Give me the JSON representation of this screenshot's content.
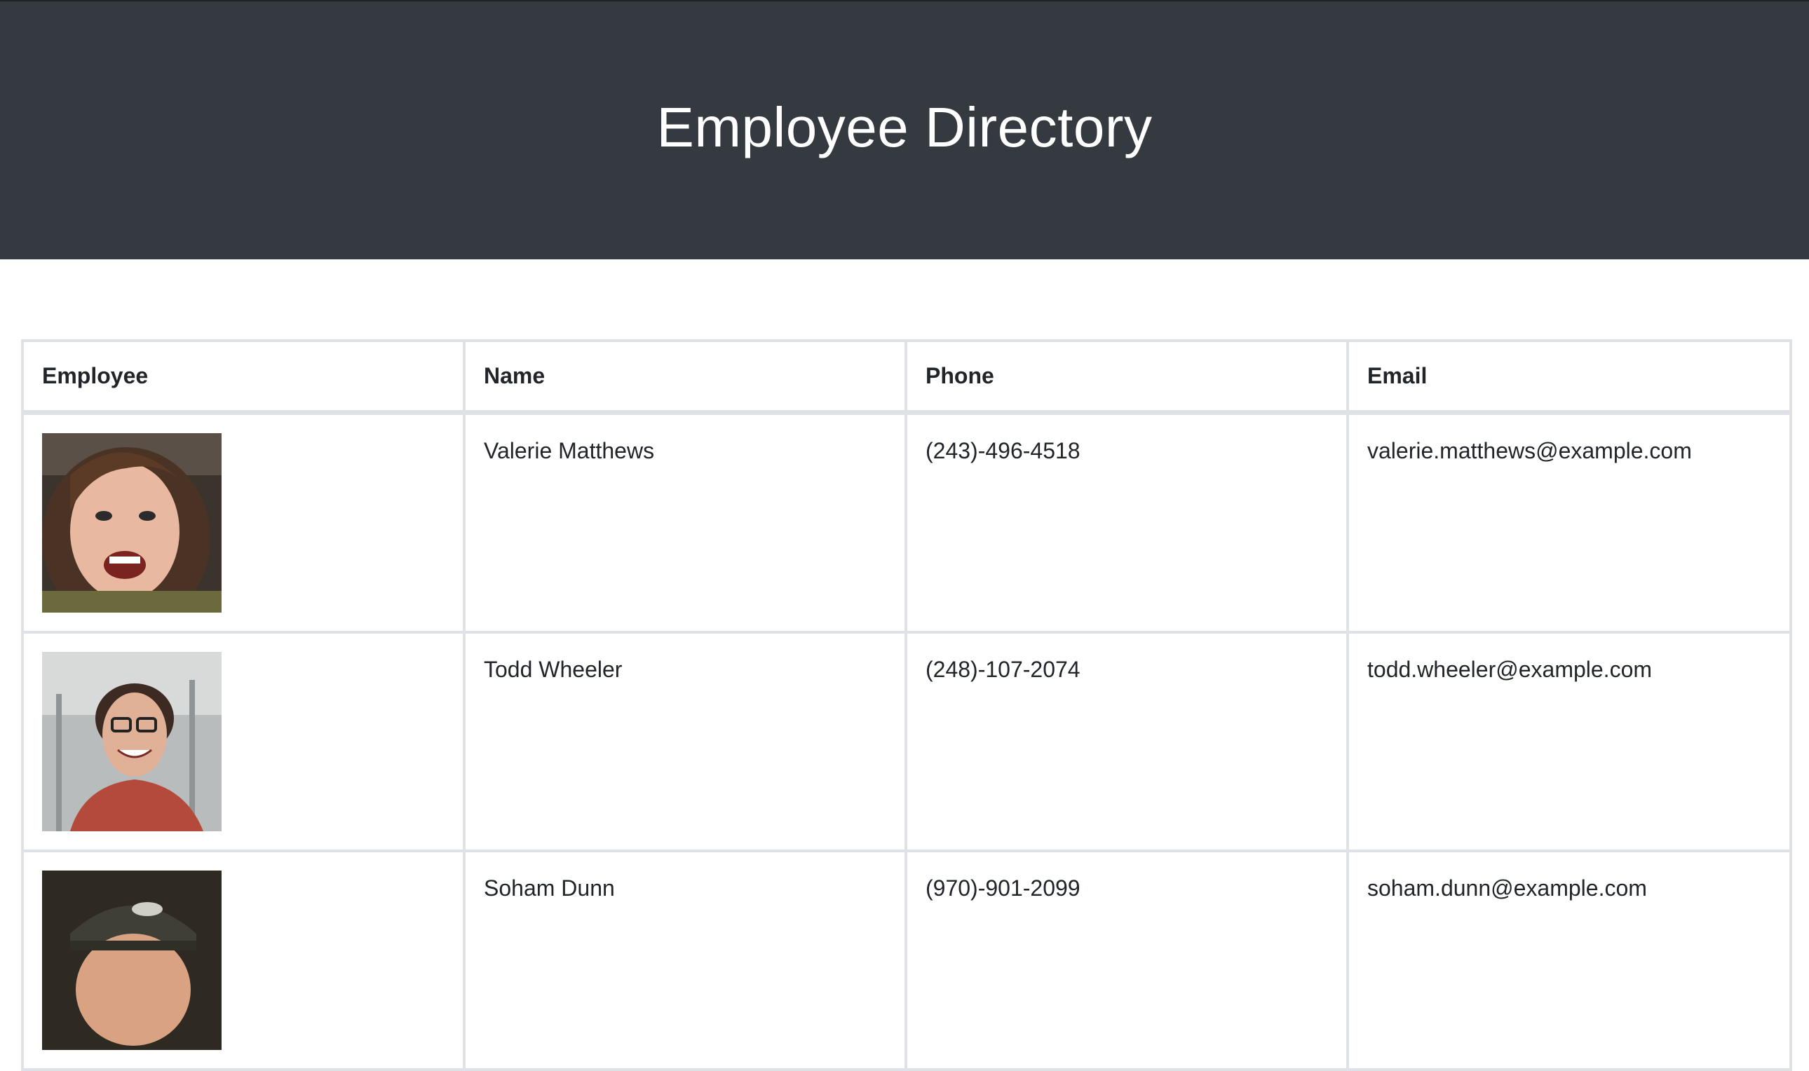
{
  "header": {
    "title": "Employee Directory"
  },
  "table": {
    "columns": [
      "Employee",
      "Name",
      "Phone",
      "Email"
    ],
    "rows": [
      {
        "photo_icon": "avatar-photo-icon",
        "name": "Valerie Matthews",
        "phone": "(243)-496-4518",
        "email": "valerie.matthews@example.com"
      },
      {
        "photo_icon": "avatar-photo-icon",
        "name": "Todd Wheeler",
        "phone": "(248)-107-2074",
        "email": "todd.wheeler@example.com"
      },
      {
        "photo_icon": "avatar-photo-icon",
        "name": "Soham Dunn",
        "phone": "(970)-901-2099",
        "email": "soham.dunn@example.com"
      }
    ]
  },
  "colors": {
    "header_bg": "#343a40",
    "header_text": "#ffffff",
    "border": "#dee2e6",
    "text": "#212529"
  }
}
